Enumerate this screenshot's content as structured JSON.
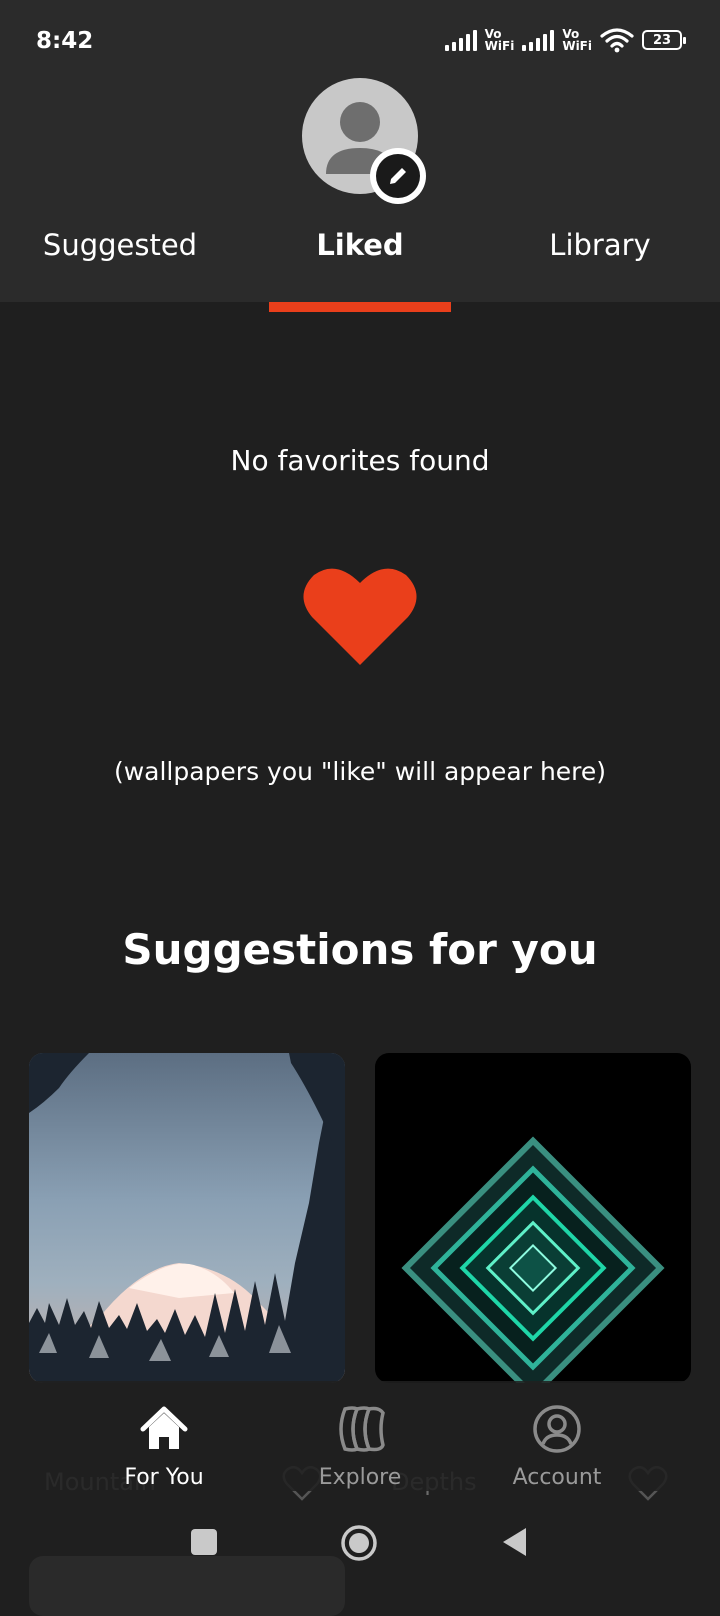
{
  "status": {
    "time": "8:42",
    "battery": "23",
    "network_label_1": "Vo\nWiFi",
    "network_label_2": "Vo\nWiFi"
  },
  "tabs": [
    {
      "label": "Suggested"
    },
    {
      "label": "Liked"
    },
    {
      "label": "Library"
    }
  ],
  "active_tab": "Liked",
  "empty_state": {
    "title": "No favorites found",
    "hint": "(wallpapers you \"like\" will appear here)"
  },
  "suggestions": {
    "title": "Suggestions for you",
    "items": [
      {
        "label": "Mountain"
      },
      {
        "label": "Depths"
      }
    ]
  },
  "bottom_nav": [
    {
      "label": "For You",
      "icon": "home-icon"
    },
    {
      "label": "Explore",
      "icon": "explore-icon"
    },
    {
      "label": "Account",
      "icon": "account-icon"
    }
  ],
  "colors": {
    "accent": "#ea3f1b",
    "background": "#1f1f1f",
    "header": "#2b2b2b"
  }
}
